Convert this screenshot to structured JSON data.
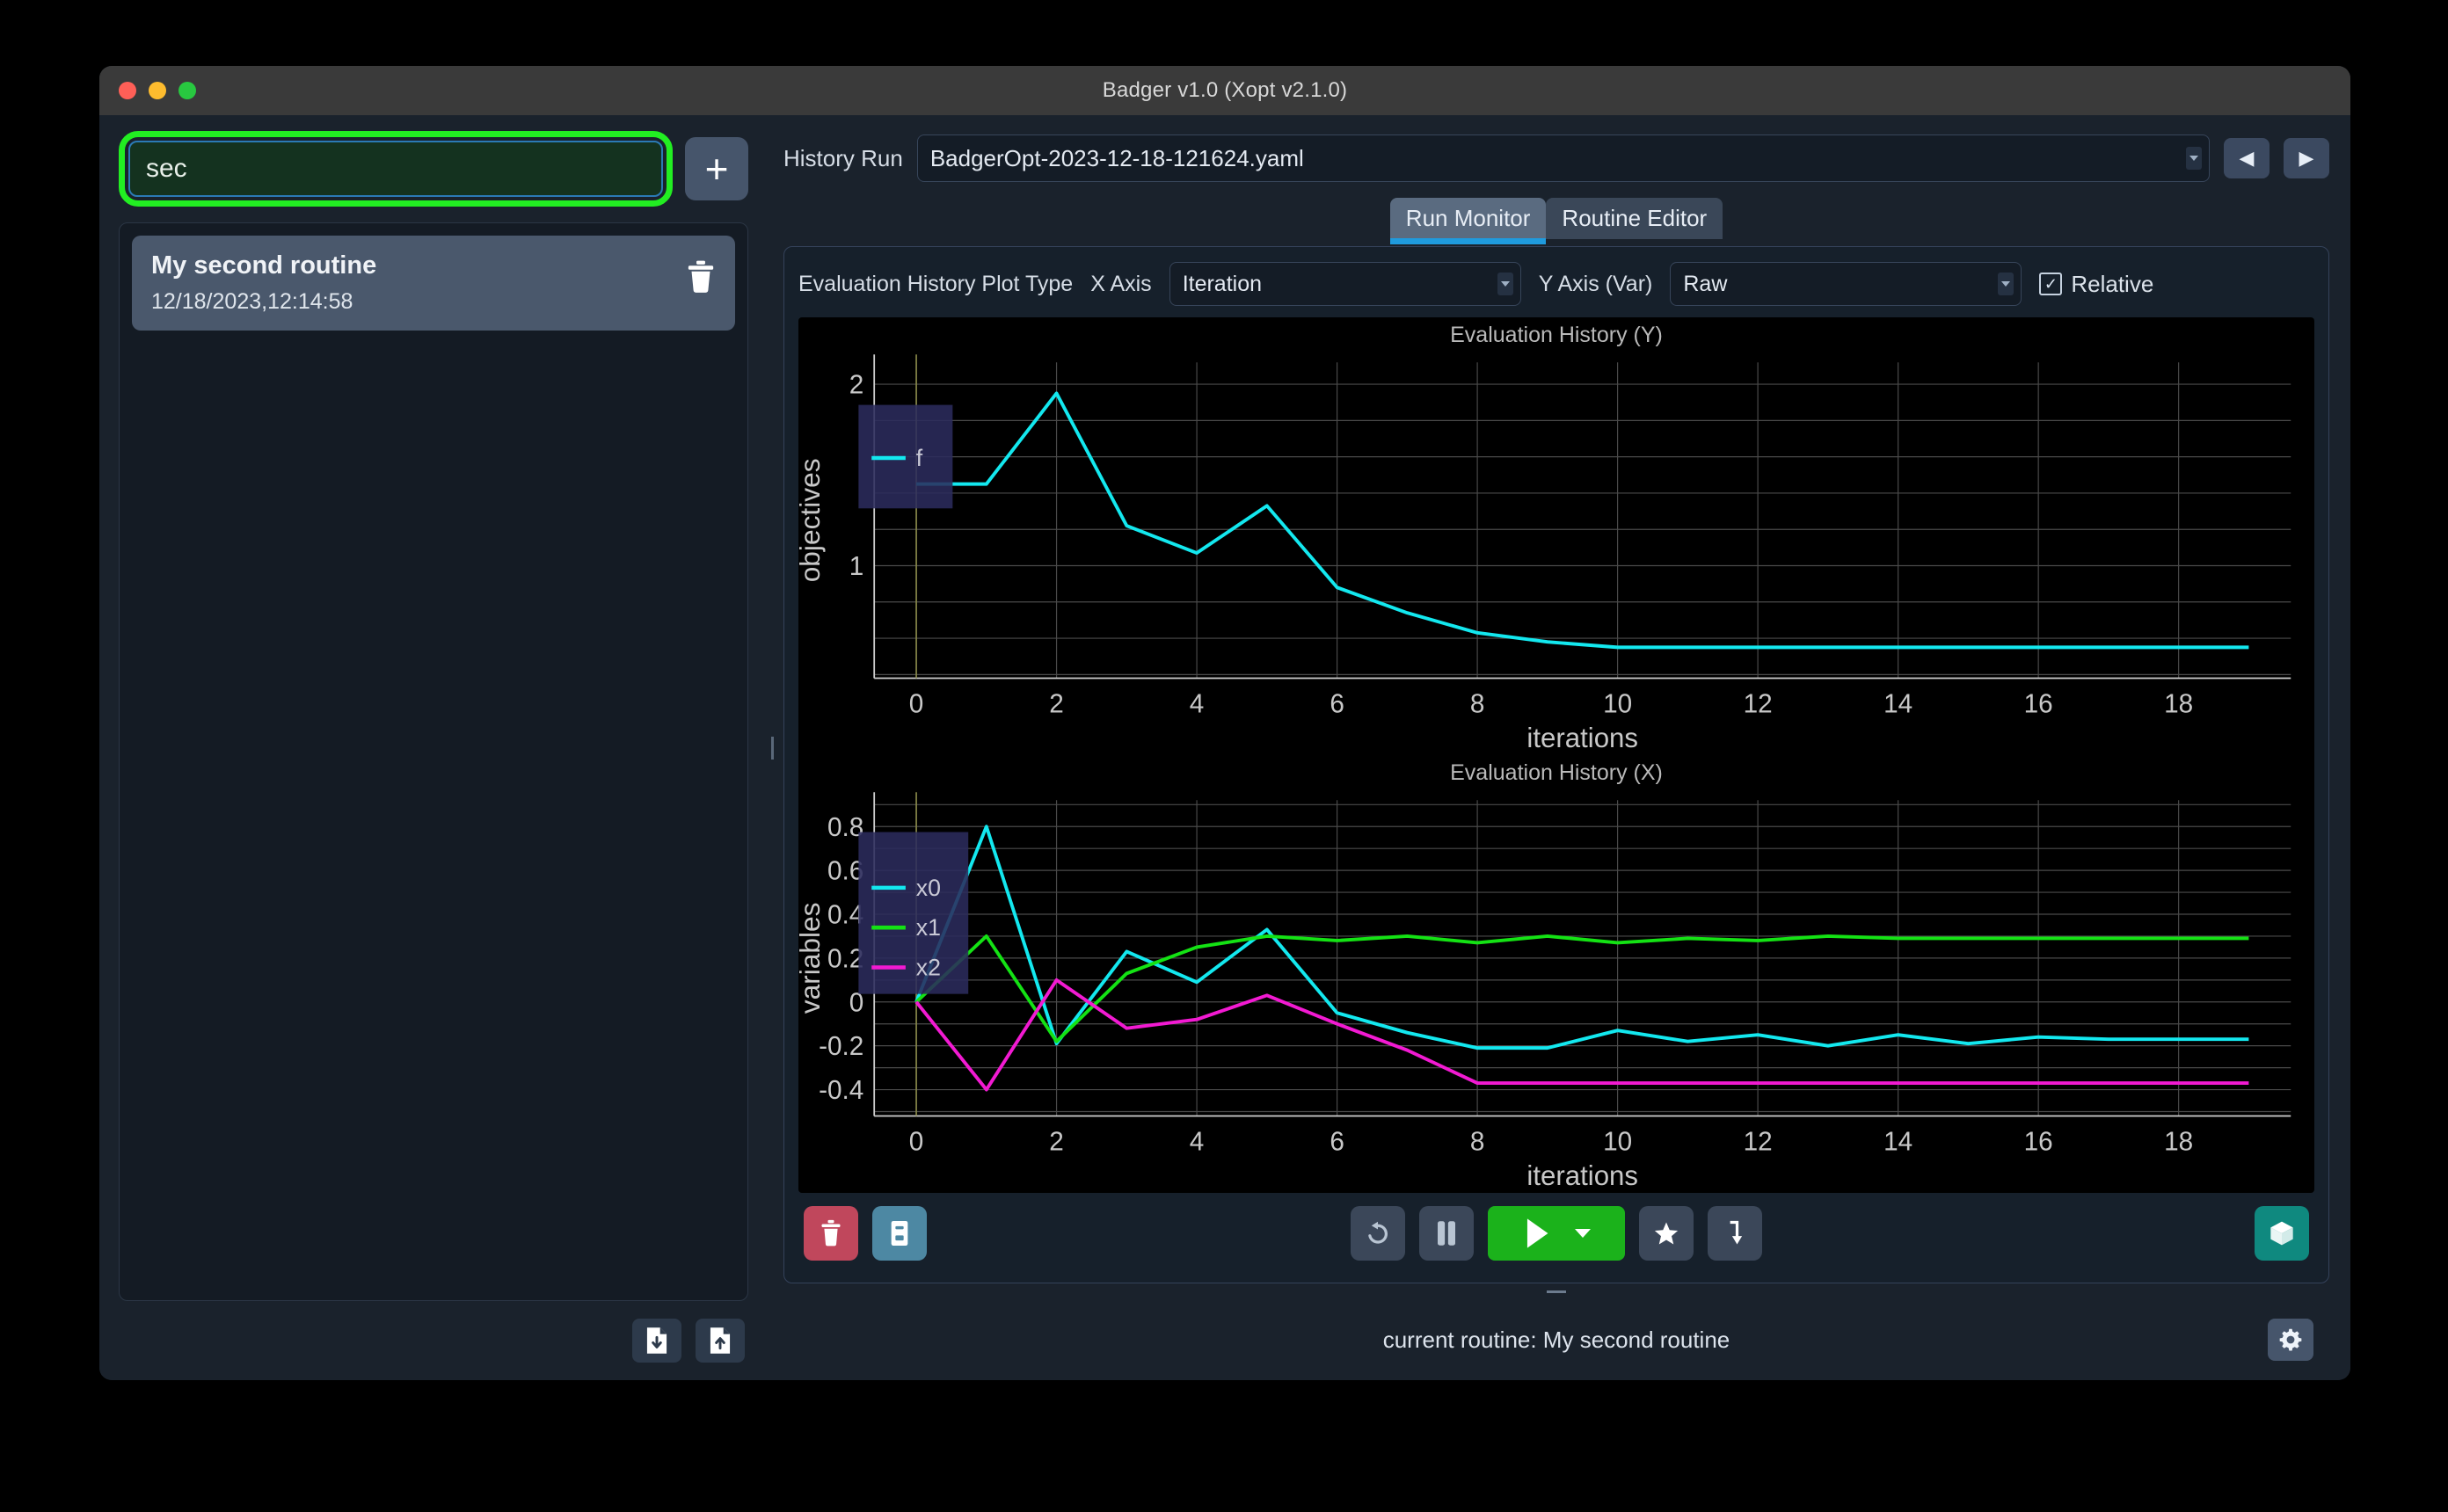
{
  "window": {
    "title": "Badger v1.0 (Xopt v2.1.0)",
    "traffic": {
      "close": "close-button",
      "minimize": "minimize-button",
      "zoom": "zoom-button"
    }
  },
  "sidebar": {
    "search": {
      "value": "sec",
      "placeholder": ""
    },
    "add_label": "+",
    "routines": [
      {
        "name": "My second routine",
        "timestamp": "12/18/2023,12:14:58"
      }
    ],
    "footer": {
      "import_label": "import-routine",
      "export_label": "export-routine"
    }
  },
  "header": {
    "history_run_label": "History Run",
    "history_run_value": "BadgerOpt-2023-12-18-121624.yaml",
    "prev_label": "◀",
    "next_label": "▶"
  },
  "tabs": [
    {
      "label": "Run Monitor",
      "active": true
    },
    {
      "label": "Routine Editor",
      "active": false
    }
  ],
  "controls": {
    "plot_type_label": "Evaluation History Plot Type",
    "x_axis_label": "X Axis",
    "x_axis_value": "Iteration",
    "y_axis_label": "Y Axis (Var)",
    "y_axis_value": "Raw",
    "relative_label": "Relative",
    "relative_checked": "✓"
  },
  "toolbar": {
    "delete_label": "delete-run",
    "logbook_label": "logbook",
    "reset_label": "reset",
    "pause_label": "pause",
    "run_label": "run",
    "run_menu_label": "run-options",
    "star_label": "set-optimum",
    "jump_label": "jump-to-optimum",
    "extension_label": "extensions"
  },
  "statusbar": {
    "text": "current routine: My second routine",
    "settings_label": "settings"
  },
  "colors": {
    "accent_green": "#22ee22",
    "run_green": "#1bb21b",
    "tab_blue": "#1f9bde",
    "series_cyan": "#13e8ef",
    "series_green": "#14e214",
    "series_magenta": "#f21ad2",
    "delete_red": "#c0475c",
    "teal": "#0f897f"
  },
  "chart_data": [
    {
      "type": "line",
      "title": "Evaluation History (Y)",
      "xlabel": "iterations",
      "ylabel": "objectives",
      "xlim": [
        -0.6,
        19.6
      ],
      "ylim": [
        0.38,
        2.12
      ],
      "xticks": [
        0,
        2,
        4,
        6,
        8,
        10,
        12,
        14,
        16,
        18
      ],
      "yticks": [
        1,
        2
      ],
      "grid": true,
      "legend": {
        "position": "top-left",
        "entries": [
          "f"
        ]
      },
      "x": [
        0,
        1,
        2,
        3,
        4,
        5,
        6,
        7,
        8,
        9,
        10,
        11,
        12,
        13,
        14,
        15,
        16,
        17,
        18,
        19
      ],
      "series": [
        {
          "name": "f",
          "color": "#13e8ef",
          "values": [
            1.45,
            1.45,
            1.95,
            1.22,
            1.07,
            1.33,
            0.88,
            0.74,
            0.63,
            0.58,
            0.55,
            0.55,
            0.55,
            0.55,
            0.55,
            0.55,
            0.55,
            0.55,
            0.55,
            0.55
          ]
        }
      ]
    },
    {
      "type": "line",
      "title": "Evaluation History (X)",
      "xlabel": "iterations",
      "ylabel": "variables",
      "xlim": [
        -0.6,
        19.6
      ],
      "ylim": [
        -0.52,
        0.92
      ],
      "xticks": [
        0,
        2,
        4,
        6,
        8,
        10,
        12,
        14,
        16,
        18
      ],
      "yticks": [
        0.8,
        0.6,
        0.4,
        0.2,
        0,
        -0.2,
        -0.4
      ],
      "grid": true,
      "legend": {
        "position": "top-left",
        "entries": [
          "x0",
          "x1",
          "x2"
        ]
      },
      "x": [
        0,
        1,
        2,
        3,
        4,
        5,
        6,
        7,
        8,
        9,
        10,
        11,
        12,
        13,
        14,
        15,
        16,
        17,
        18,
        19
      ],
      "series": [
        {
          "name": "x0",
          "color": "#13e8ef",
          "values": [
            0,
            0.8,
            -0.19,
            0.23,
            0.09,
            0.33,
            -0.05,
            -0.14,
            -0.21,
            -0.21,
            -0.13,
            -0.18,
            -0.15,
            -0.2,
            -0.15,
            -0.19,
            -0.16,
            -0.17,
            -0.17,
            -0.17
          ]
        },
        {
          "name": "x1",
          "color": "#14e214",
          "values": [
            0,
            0.3,
            -0.18,
            0.13,
            0.25,
            0.3,
            0.28,
            0.3,
            0.27,
            0.3,
            0.27,
            0.29,
            0.28,
            0.3,
            0.29,
            0.29,
            0.29,
            0.29,
            0.29,
            0.29
          ]
        },
        {
          "name": "x2",
          "color": "#f21ad2",
          "values": [
            0,
            -0.4,
            0.1,
            -0.12,
            -0.08,
            0.03,
            -0.1,
            -0.22,
            -0.37,
            -0.37,
            -0.37,
            -0.37,
            -0.37,
            -0.37,
            -0.37,
            -0.37,
            -0.37,
            -0.37,
            -0.37,
            -0.37
          ]
        }
      ]
    }
  ]
}
